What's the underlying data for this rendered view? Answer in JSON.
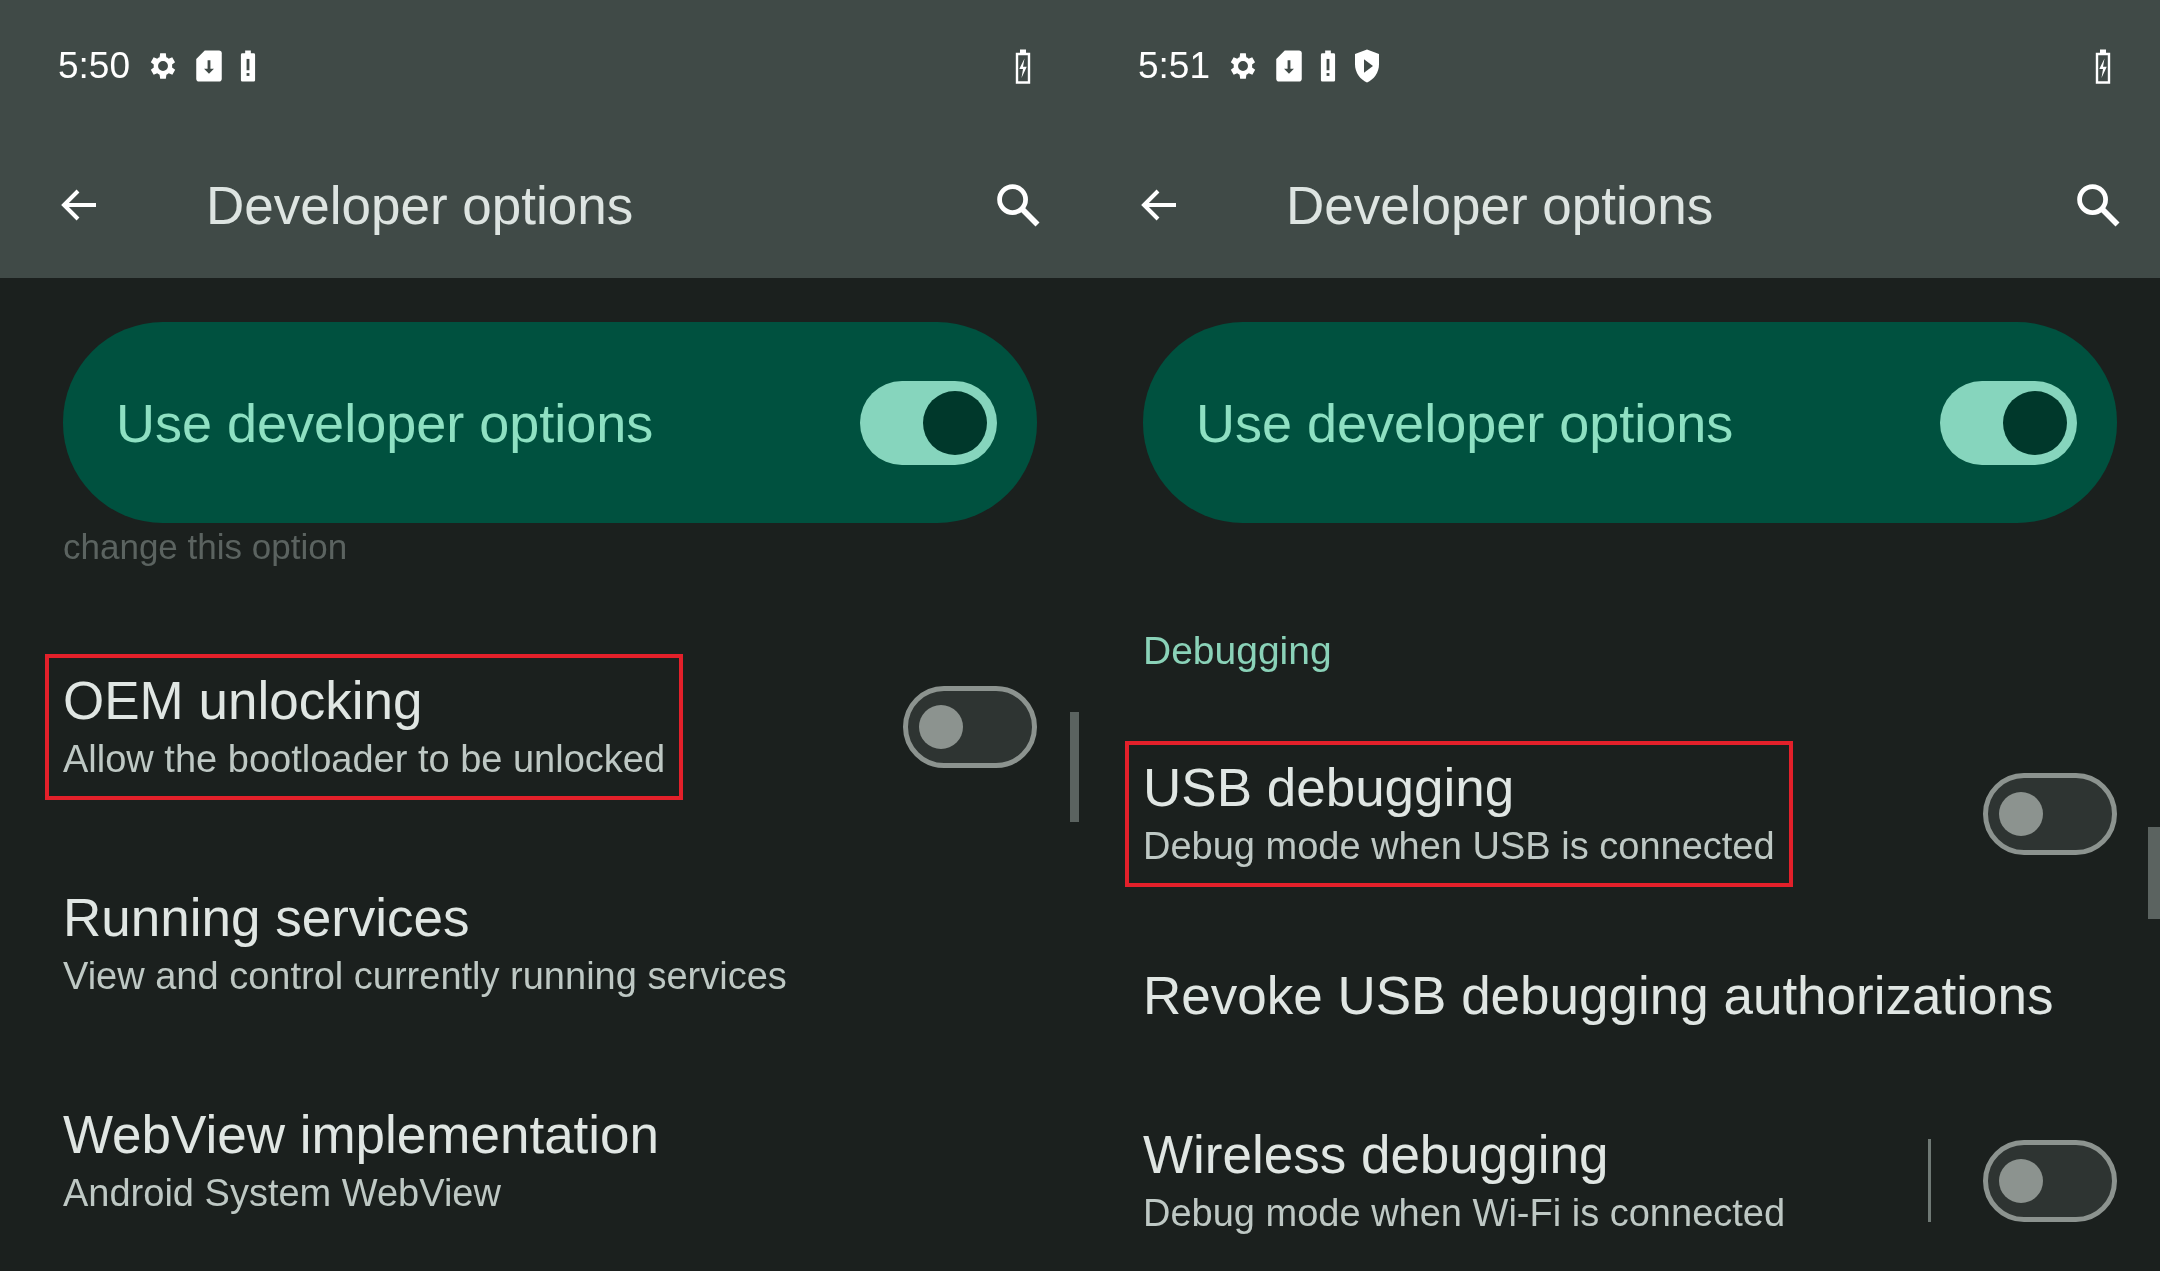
{
  "screens": [
    {
      "status_bar": {
        "time": "5:50",
        "notifications": [
          {
            "kind": "settings"
          },
          {
            "kind": "download"
          },
          {
            "kind": "alert"
          }
        ]
      },
      "app_bar": {
        "title": "Developer options"
      },
      "main_switch": {
        "label": "Use developer options",
        "on": true
      },
      "items": [
        {
          "kind": "note",
          "lines": [
            "change this option"
          ]
        },
        {
          "kind": "setting",
          "title": "OEM unlocking",
          "summary": "Allow the bootloader to be unlocked",
          "highlighted": true,
          "toggle": {
            "on": false
          },
          "divider": false
        },
        {
          "kind": "setting",
          "title": "Running services",
          "summary": "View and control currently running services",
          "highlighted": false
        },
        {
          "kind": "setting",
          "title": "WebView implementation",
          "summary": "Android System WebView",
          "highlighted": false
        }
      ]
    },
    {
      "status_bar": {
        "time": "5:51",
        "notifications": [
          {
            "kind": "settings"
          },
          {
            "kind": "download"
          },
          {
            "kind": "alert"
          },
          {
            "kind": "shield"
          }
        ]
      },
      "app_bar": {
        "title": "Developer options"
      },
      "main_switch": {
        "label": "Use developer options",
        "on": true
      },
      "items": [
        {
          "kind": "header",
          "title": "Debugging"
        },
        {
          "kind": "setting",
          "title": "USB debugging",
          "summary": "Debug mode when USB is connected",
          "highlighted": true,
          "toggle": {
            "on": false
          },
          "divider": false
        },
        {
          "kind": "setting",
          "title": "Revoke USB debugging authorizations",
          "highlighted": false
        },
        {
          "kind": "setting",
          "title": "Wireless debugging",
          "summary": "Debug mode when Wi-Fi is connected",
          "highlighted": false,
          "toggle": {
            "on": false
          },
          "divider": true
        }
      ]
    }
  ]
}
